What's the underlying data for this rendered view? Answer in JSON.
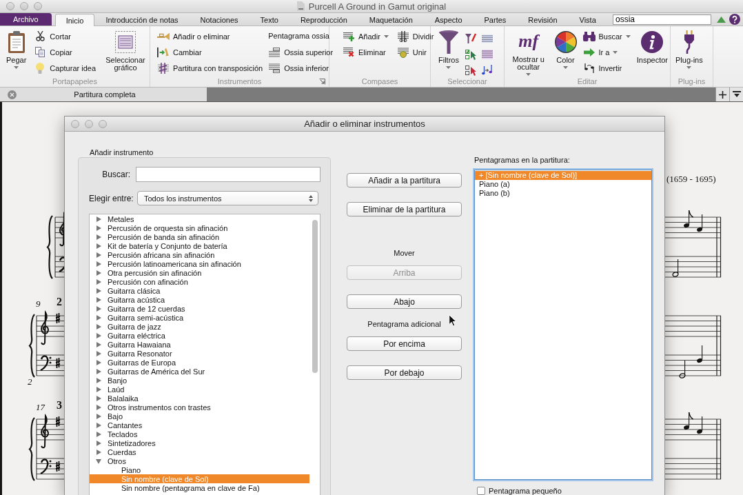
{
  "window": {
    "title": "Purcell A Ground in Gamut original"
  },
  "ribbon": {
    "file_tab": "Archivo",
    "tabs": [
      {
        "label": "Inicio",
        "selected": true
      },
      {
        "label": "Introducción de notas",
        "selected": false
      },
      {
        "label": "Notaciones",
        "selected": false
      },
      {
        "label": "Texto",
        "selected": false
      },
      {
        "label": "Reproducción",
        "selected": false
      },
      {
        "label": "Maquetación",
        "selected": false
      },
      {
        "label": "Aspecto",
        "selected": false
      },
      {
        "label": "Partes",
        "selected": false
      },
      {
        "label": "Revisión",
        "selected": false
      },
      {
        "label": "Vista",
        "selected": false
      }
    ],
    "search": {
      "value": "ossia"
    },
    "groups": [
      {
        "label": "Portapapeles",
        "launcher": false,
        "columns": [
          {
            "kind": "large",
            "label": "Pegar",
            "menu": true
          },
          {
            "kind": "stack",
            "items": [
              {
                "kind": "button",
                "label": "Cortar",
                "menu": false
              },
              {
                "kind": "button",
                "label": "Copiar",
                "menu": false
              },
              {
                "kind": "button",
                "label": "Capturar idea",
                "menu": false
              }
            ]
          },
          {
            "kind": "large",
            "label": "Seleccionar gráfico",
            "menu": false
          }
        ]
      },
      {
        "label": "Instrumentos",
        "launcher": true,
        "columns": [
          {
            "kind": "stack",
            "items": [
              {
                "kind": "button",
                "label": "Añadir o eliminar",
                "menu": false
              },
              {
                "kind": "button",
                "label": "Cambiar",
                "menu": false
              },
              {
                "kind": "button",
                "label": "Partitura con transposición",
                "menu": false
              }
            ]
          },
          {
            "kind": "stack",
            "items": [
              {
                "kind": "heading",
                "label": "Pentagrama ossia"
              },
              {
                "kind": "button",
                "label": "Ossia superior",
                "menu": false
              },
              {
                "kind": "button",
                "label": "Ossia inferior",
                "menu": false
              }
            ]
          }
        ]
      },
      {
        "label": "Compases",
        "launcher": false,
        "columns": [
          {
            "kind": "stack",
            "items": [
              {
                "kind": "button",
                "label": "Añadir",
                "menu": true
              },
              {
                "kind": "button",
                "label": "Eliminar",
                "menu": false
              }
            ]
          },
          {
            "kind": "stack",
            "items": [
              {
                "kind": "button",
                "label": "Dividir",
                "menu": false
              },
              {
                "kind": "button",
                "label": "Unir",
                "menu": false
              }
            ]
          }
        ]
      },
      {
        "label": "Seleccionar",
        "launcher": false,
        "columns": [
          {
            "kind": "large",
            "label": "Filtros",
            "menu": true
          },
          {
            "kind": "icon_grid"
          }
        ]
      },
      {
        "label": "Editar",
        "launcher": false,
        "columns": [
          {
            "kind": "large",
            "label": "Mostrar u ocultar",
            "menu": true,
            "glyph": "mf"
          },
          {
            "kind": "large",
            "label": "Color",
            "menu": true
          },
          {
            "kind": "stack",
            "items": [
              {
                "kind": "button",
                "label": "Buscar",
                "menu": true
              },
              {
                "kind": "button",
                "label": "Ir a",
                "menu": true
              },
              {
                "kind": "button",
                "label": "Invertir",
                "menu": false
              }
            ]
          },
          {
            "kind": "large",
            "label": "Inspector",
            "menu": false
          }
        ]
      },
      {
        "label": "Plug-ins",
        "launcher": false,
        "columns": [
          {
            "kind": "large",
            "label": "Plug-ins",
            "menu": true
          }
        ]
      }
    ]
  },
  "document_tabs": [
    {
      "label": "Partitura completa",
      "selected": true
    }
  ],
  "score": {
    "composer_dates": "(1659 - 1695)",
    "systems": [
      {
        "sharps": false
      },
      {
        "sharps": true,
        "bar_number": "9",
        "rehearsal_mark": "2",
        "number_below": "2"
      },
      {
        "sharps": true,
        "bar_number": "17",
        "rehearsal_mark": "3"
      }
    ]
  },
  "dialog": {
    "title": "Añadir o eliminar instrumentos",
    "add_instrument": {
      "label": "Añadir instrumento",
      "search_label": "Buscar:",
      "choose_label": "Elegir entre:",
      "choose_value": "Todos los instrumentos",
      "instruments": [
        {
          "label": "Metales",
          "expanded": false,
          "selected": false
        },
        {
          "label": "Percusión de orquesta sin afinación",
          "expanded": false,
          "selected": false
        },
        {
          "label": "Percusión de banda sin afinación",
          "expanded": false,
          "selected": false
        },
        {
          "label": "Kit de batería y Conjunto de batería",
          "expanded": false,
          "selected": false
        },
        {
          "label": "Percusión africana sin afinación",
          "expanded": false,
          "selected": false
        },
        {
          "label": "Percusión latinoamericana sin afinación",
          "expanded": false,
          "selected": false
        },
        {
          "label": "Otra percusión sin afinación",
          "expanded": false,
          "selected": false
        },
        {
          "label": "Percusión con afinación",
          "expanded": false,
          "selected": false
        },
        {
          "label": "Guitarra clásica",
          "expanded": false,
          "selected": false
        },
        {
          "label": "Guitarra acústica",
          "expanded": false,
          "selected": false
        },
        {
          "label": "Guitarra de 12 cuerdas",
          "expanded": false,
          "selected": false
        },
        {
          "label": "Guitarra semi-acústica",
          "expanded": false,
          "selected": false
        },
        {
          "label": "Guitarra de jazz",
          "expanded": false,
          "selected": false
        },
        {
          "label": "Guitarra eléctrica",
          "expanded": false,
          "selected": false
        },
        {
          "label": "Guitarra Hawaiana",
          "expanded": false,
          "selected": false
        },
        {
          "label": "Guitarra Resonator",
          "expanded": false,
          "selected": false
        },
        {
          "label": "Guitarras de Europa",
          "expanded": false,
          "selected": false
        },
        {
          "label": "Guitarras de América del Sur",
          "expanded": false,
          "selected": false
        },
        {
          "label": "Banjo",
          "expanded": false,
          "selected": false
        },
        {
          "label": "Laúd",
          "expanded": false,
          "selected": false
        },
        {
          "label": "Balalaika",
          "expanded": false,
          "selected": false
        },
        {
          "label": "Otros instrumentos con trastes",
          "expanded": false,
          "selected": false
        },
        {
          "label": "Bajo",
          "expanded": false,
          "selected": false
        },
        {
          "label": "Cantantes",
          "expanded": false,
          "selected": false
        },
        {
          "label": "Teclados",
          "expanded": false,
          "selected": false
        },
        {
          "label": "Sintetizadores",
          "expanded": false,
          "selected": false
        },
        {
          "label": "Cuerdas",
          "expanded": false,
          "selected": false
        },
        {
          "label": "Otros",
          "expanded": true,
          "selected": false,
          "children": [
            {
              "label": "Piano",
              "selected": false
            },
            {
              "label": "Sin nombre (clave de Sol)",
              "selected": true
            },
            {
              "label": "Sin nombre (pentagrama en clave de Fa)",
              "selected": false
            }
          ]
        }
      ]
    },
    "actions": [
      {
        "buttons": [
          {
            "label": "Añadir a la partitura",
            "disabled": false
          },
          {
            "label": "Eliminar de la partitura",
            "disabled": false
          }
        ]
      },
      {
        "heading": "Mover",
        "buttons": [
          {
            "label": "Arriba",
            "disabled": true
          },
          {
            "label": "Abajo",
            "disabled": false
          }
        ]
      },
      {
        "heading": "Pentagrama adicional",
        "buttons": [
          {
            "label": "Por encima",
            "disabled": false
          },
          {
            "label": "Por debajo",
            "disabled": false
          }
        ]
      }
    ],
    "staves": {
      "label": "Pentagramas en la partitura:",
      "items": [
        {
          "label": "+ [Sin nombre (clave de Sol)]",
          "selected": true
        },
        {
          "label": "Piano (a)",
          "selected": false
        },
        {
          "label": "Piano (b)",
          "selected": false
        }
      ]
    },
    "small_staff": {
      "label": "Pentagrama pequeño",
      "checked": false
    }
  }
}
